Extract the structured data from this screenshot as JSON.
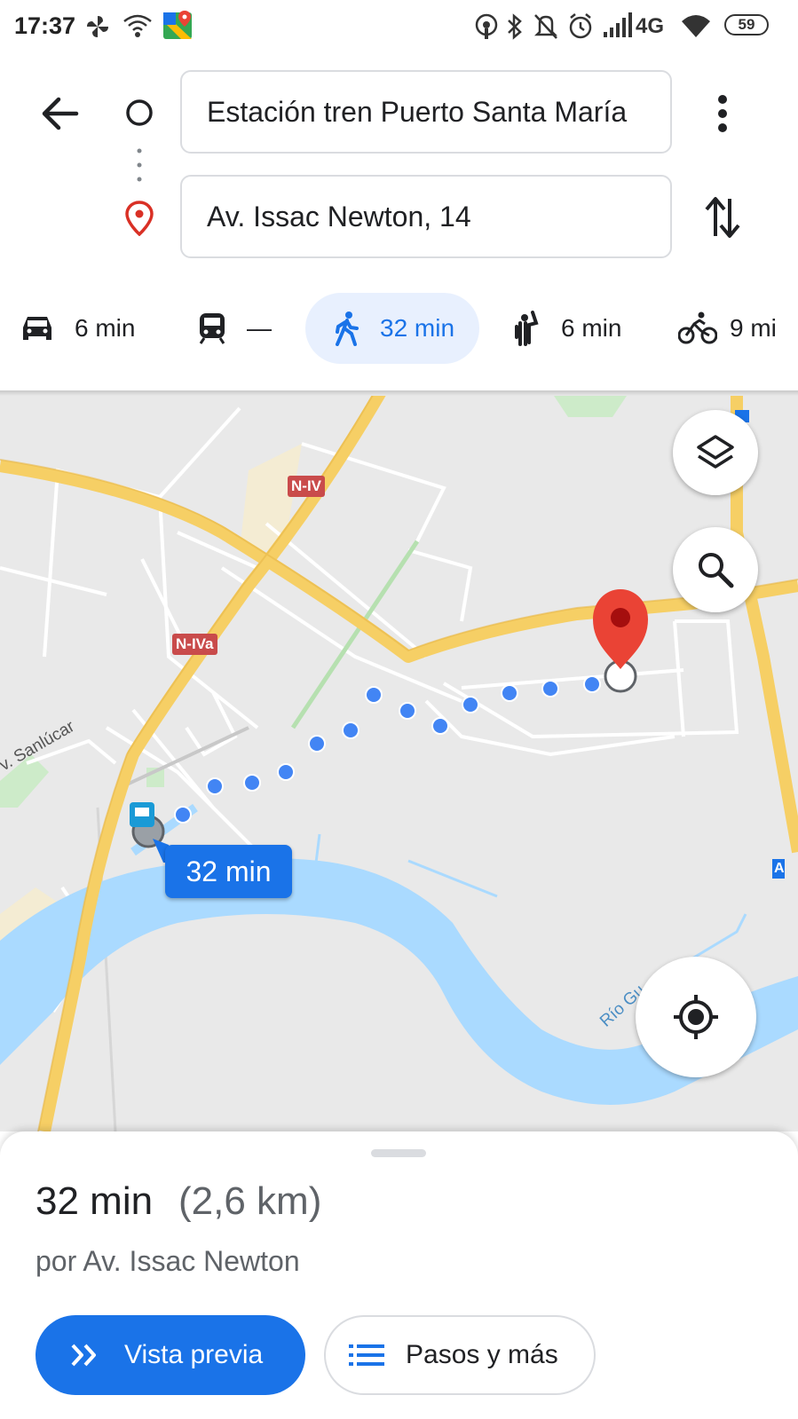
{
  "status_bar": {
    "time": "17:37",
    "network": "4G",
    "battery": "59"
  },
  "directions": {
    "origin": "Estación tren Puerto Santa María",
    "destination": "Av. Issac Newton, 14"
  },
  "modes": [
    {
      "icon": "car-icon",
      "label": "6 min"
    },
    {
      "icon": "train-icon",
      "label": "—"
    },
    {
      "icon": "walk-icon",
      "label": "32 min",
      "active": true
    },
    {
      "icon": "rideshare-icon",
      "label": "6 min"
    },
    {
      "icon": "bike-icon",
      "label": "9 mi"
    }
  ],
  "map": {
    "road_labels": [
      "N-IV",
      "N-IVa"
    ],
    "street_label": "v. Sanlúcar",
    "river_label": "Río Gu",
    "route_time": "32 min",
    "edge_label": "A"
  },
  "route": {
    "duration": "32 min",
    "distance": "(2,6 km)",
    "via": "por Av. Issac Newton"
  },
  "actions": {
    "preview_label": "Vista previa",
    "steps_label": "Pasos y más"
  },
  "colors": {
    "accent": "#1a73e8",
    "road": "#f6cf65",
    "water": "#aadaff",
    "pin": "#ea4335"
  }
}
